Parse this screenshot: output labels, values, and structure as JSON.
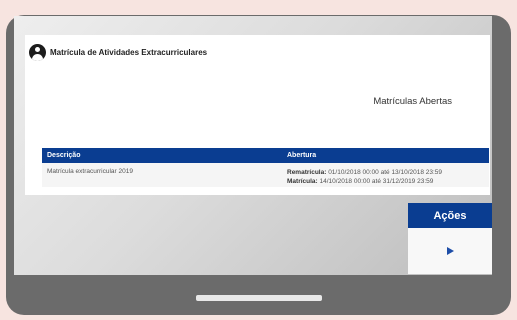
{
  "header": {
    "title": "Matrícula de Atividades Extracurriculares"
  },
  "subtitle": "Matrículas Abertas",
  "table": {
    "columns": [
      "Descrição",
      "Abertura"
    ],
    "rows": [
      {
        "descricao": "Matrícula extracurricular 2019",
        "rematricula_label": "Rematrícula:",
        "rematricula_value": "01/10/2018 00:00 até 13/10/2018 23:59",
        "matricula_label": "Matrícula:",
        "matricula_value": "14/10/2018 00:00 até 31/12/2019 23:59"
      }
    ]
  },
  "actions": {
    "header": "Ações",
    "row_icon": "play-icon"
  },
  "colors": {
    "header_blue": "#0a3d91",
    "play_blue": "#1e4ea8",
    "monitor_frame": "#6b6b6b",
    "background": "#f7e4e0"
  }
}
